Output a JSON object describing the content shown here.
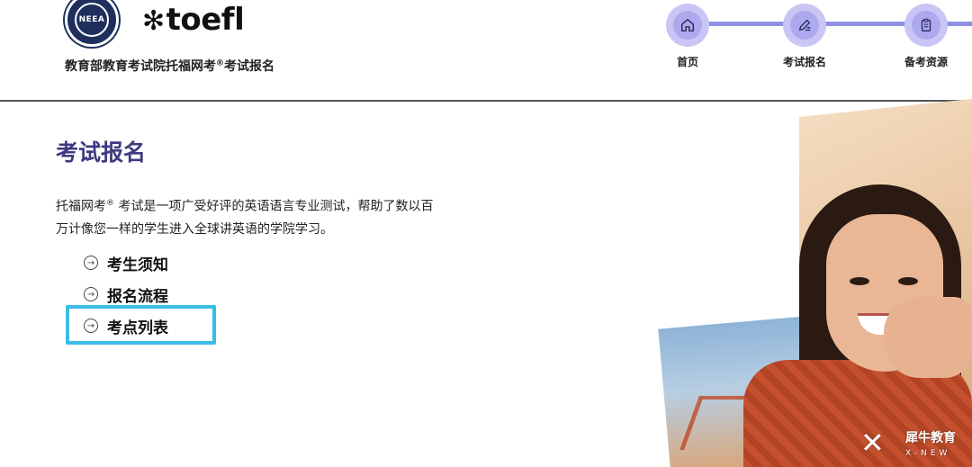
{
  "header": {
    "neea_logo_text": "NEEA",
    "toefl_logo_text": "toefl",
    "site_subtitle_main": "教育部教育考试院托福网考",
    "site_subtitle_reg": "®",
    "site_subtitle_tail": "考试报名"
  },
  "nav": {
    "steps": [
      {
        "label": "首页",
        "icon": "home-icon"
      },
      {
        "label": "考试报名",
        "icon": "edit-icon"
      },
      {
        "label": "备考资源",
        "icon": "clipboard-icon"
      }
    ]
  },
  "main": {
    "title": "考试报名",
    "intro_pre": "托福网考",
    "intro_reg": "®",
    "intro_post": " 考试是一项广受好评的英语语言专业测试，帮助了数以百万计像您一样的学生进入全球讲英语的学院学习。",
    "menu": [
      {
        "label": "考生须知"
      },
      {
        "label": "报名流程"
      },
      {
        "label": "考点列表"
      }
    ]
  },
  "watermark": {
    "cn": "犀牛教育",
    "en": "X-NEW"
  },
  "colors": {
    "title": "#3e3a80",
    "nav_line": "#8f8fe4",
    "nav_circle": "#c9c6f5",
    "highlight": "#3bbde8"
  }
}
